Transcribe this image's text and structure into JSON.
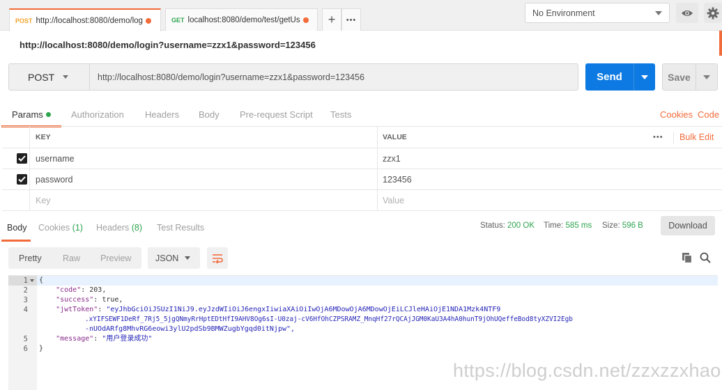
{
  "tabs": [
    {
      "method": "POST",
      "url": "http://localhost:8080/demo/log"
    },
    {
      "method": "GET",
      "url": "localhost:8080/demo/test/getUs"
    }
  ],
  "tab_actions": {
    "add": "+",
    "more": "•••"
  },
  "environment": {
    "selected": "No Environment"
  },
  "request": {
    "title": "http://localhost:8080/demo/login?username=zzx1&password=123456",
    "method": "POST",
    "url": "http://localhost:8080/demo/login?username=zzx1&password=123456",
    "send_label": "Send",
    "save_label": "Save"
  },
  "request_tabs": [
    "Params",
    "Authorization",
    "Headers",
    "Body",
    "Pre-request Script",
    "Tests"
  ],
  "request_links": {
    "cookies": "Cookies",
    "code": "Code"
  },
  "params": {
    "key_header": "KEY",
    "value_header": "VALUE",
    "more": "•••",
    "bulk_edit": "Bulk Edit",
    "rows": [
      {
        "key": "username",
        "value": "zzx1",
        "checked": true
      },
      {
        "key": "password",
        "value": "123456",
        "checked": true
      }
    ],
    "key_placeholder": "Key",
    "value_placeholder": "Value"
  },
  "response_tabs": {
    "body": "Body",
    "cookies": "Cookies",
    "cookies_count": "(1)",
    "headers": "Headers",
    "headers_count": "(8)",
    "tests": "Test Results"
  },
  "response_status": {
    "status_label": "Status:",
    "status_value": "200 OK",
    "time_label": "Time:",
    "time_value": "585 ms",
    "size_label": "Size:",
    "size_value": "596 B",
    "download": "Download"
  },
  "format": {
    "pretty": "Pretty",
    "raw": "Raw",
    "preview": "Preview",
    "type": "JSON"
  },
  "code": {
    "line_numbers": [
      "1",
      "2",
      "3",
      "4",
      "",
      "",
      "5",
      "6"
    ],
    "open": "{",
    "code_key": "\"code\"",
    "code_val": "203,",
    "success_key": "\"success\"",
    "success_val": "true,",
    "jwt_key": "\"jwtToken\"",
    "jwt_1": "\"eyJhbGciOiJSUzI1NiJ9.eyJzdWIiOiJ6engxIiwiaXAiOiIwOjA6MDowOjA6MDowOjEiLCJleHAiOjE1NDA1Mzk4NTF9",
    "jwt_2": ".xYIFSEWF1DeRf_7Rj5_5jgQNmyRrHptEDtHfI9AHV8Og6sI-U0zaj-cV6HfOhCZPSRAMZ_MnqHf27rQCAjJGM0KaU3A4hA0hunT9jOhUQeffeBod8tyXZVI2Egb",
    "jwt_3": "-nUOdARfg8MhvRG6eowi3ylU2pdSb9BMWZugbYgqd0itNjpw\",",
    "message_key": "\"message\"",
    "message_val": "\"用户登录成功\"",
    "close": "}"
  },
  "watermark": "https://blog.csdn.net/zzxzzxhao"
}
